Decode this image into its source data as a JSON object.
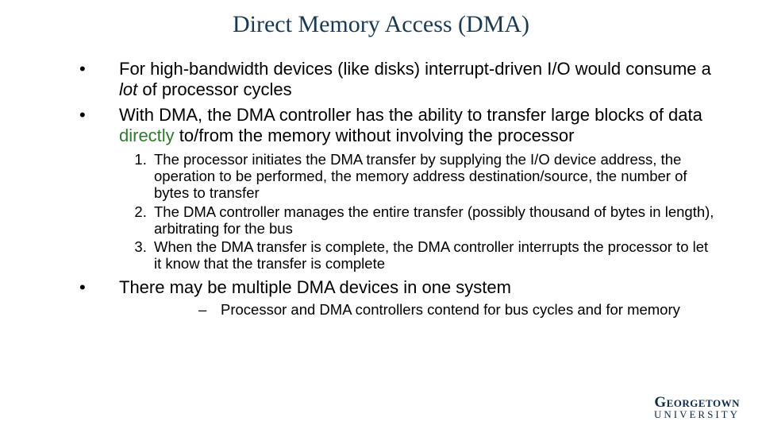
{
  "title": "Direct Memory Access (DMA)",
  "bullets": {
    "b1": {
      "pre": "For high-bandwidth devices (like disks) interrupt-driven I/O would consume a ",
      "em": "lot",
      "post": " of processor cycles"
    },
    "b2": {
      "pre": "With DMA, the DMA controller has the ability to transfer large blocks of data ",
      "em": "directly",
      "post": " to/from the memory without involving the processor"
    },
    "steps": {
      "s1": "The processor initiates the DMA transfer by supplying the I/O device address, the operation to be performed, the memory address destination/source, the number of bytes to transfer",
      "s2": "The DMA controller manages the entire transfer (possibly thousand of bytes in length), arbitrating for the bus",
      "s3": "When the DMA transfer is complete, the DMA controller interrupts the processor to let it know that the transfer is complete"
    },
    "b3": "There may be multiple DMA devices in one system",
    "sub3": "Processor and DMA controllers contend for bus cycles and for memory"
  },
  "logo": {
    "line1": "Georgetown",
    "line2": "UNIVERSITY"
  }
}
